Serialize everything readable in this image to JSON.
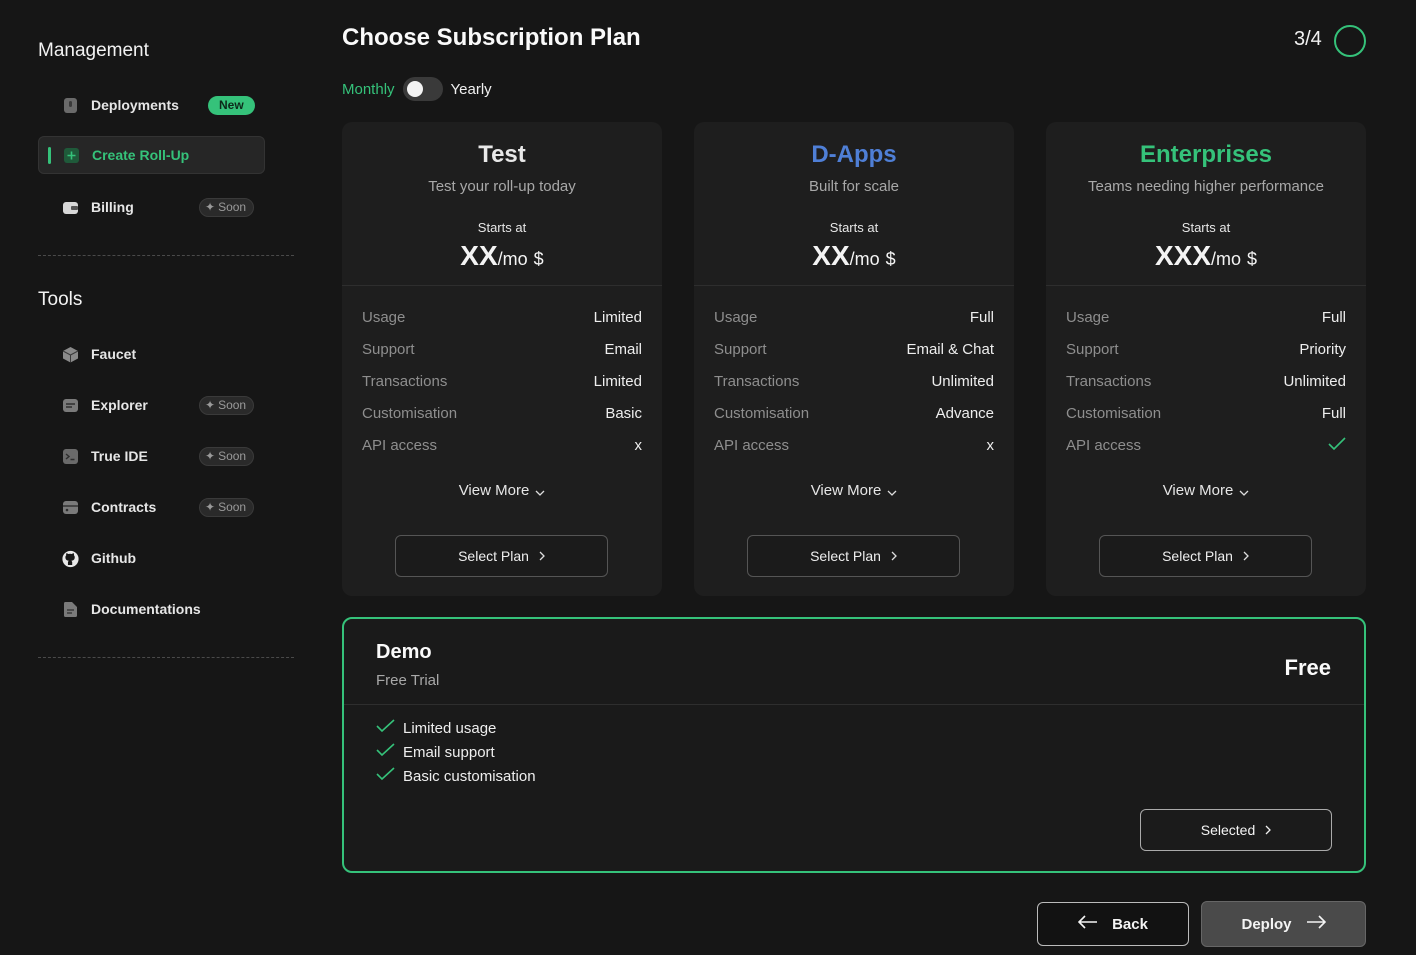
{
  "sidebar": {
    "management_title": "Management",
    "tools_title": "Tools",
    "management_items": [
      {
        "label": "Deployments",
        "badge": "New"
      },
      {
        "label": "Create Roll-Up"
      },
      {
        "label": "Billing",
        "badge": "Soon"
      }
    ],
    "tools_items": [
      {
        "label": "Faucet"
      },
      {
        "label": "Explorer",
        "badge": "Soon"
      },
      {
        "label": "True IDE",
        "badge": "Soon"
      },
      {
        "label": "Contracts",
        "badge": "Soon"
      },
      {
        "label": "Github"
      },
      {
        "label": "Documentations"
      }
    ]
  },
  "header": {
    "title": "Choose Subscription Plan",
    "step": "3/4"
  },
  "billing_toggle": {
    "left": "Monthly",
    "right": "Yearly"
  },
  "plans": [
    {
      "name": "Test",
      "name_color": "#e8e8e8",
      "description": "Test your roll-up today",
      "starts_at": "Starts at",
      "price": "XX",
      "per": "/mo",
      "currency": "$",
      "features": [
        {
          "k": "Usage",
          "v": "Limited"
        },
        {
          "k": "Support",
          "v": "Email"
        },
        {
          "k": "Transactions",
          "v": "Limited"
        },
        {
          "k": "Customisation",
          "v": "Basic"
        },
        {
          "k": "API access",
          "v": "x"
        }
      ],
      "view_more": "View More",
      "select": "Select Plan"
    },
    {
      "name": "D-Apps",
      "name_color": "#4f7fd6",
      "description": "Built for scale",
      "starts_at": "Starts at",
      "price": "XX",
      "per": "/mo",
      "currency": "$",
      "features": [
        {
          "k": "Usage",
          "v": "Full"
        },
        {
          "k": "Support",
          "v": "Email & Chat"
        },
        {
          "k": "Transactions",
          "v": "Unlimited"
        },
        {
          "k": "Customisation",
          "v": "Advance"
        },
        {
          "k": "API access",
          "v": "x"
        }
      ],
      "view_more": "View More",
      "select": "Select Plan"
    },
    {
      "name": "Enterprises",
      "name_color": "#35c27a",
      "description": "Teams needing higher performance",
      "starts_at": "Starts at",
      "price": "XXX",
      "per": "/mo",
      "currency": "$",
      "features": [
        {
          "k": "Usage",
          "v": "Full"
        },
        {
          "k": "Support",
          "v": "Priority"
        },
        {
          "k": "Transactions",
          "v": "Unlimited"
        },
        {
          "k": "Customisation",
          "v": "Full"
        },
        {
          "k": "API access",
          "v": ""
        }
      ],
      "view_more": "View More",
      "select": "Select Plan"
    }
  ],
  "demo": {
    "name": "Demo",
    "subtitle": "Free Trial",
    "price": "Free",
    "features": [
      "Limited usage",
      "Email support",
      "Basic customisation"
    ],
    "button": "Selected"
  },
  "footer": {
    "back": "Back",
    "deploy": "Deploy"
  },
  "colors": {
    "accent": "#35c27a",
    "dapps": "#4f7fd6",
    "background": "#161616",
    "card": "#1e1e1e"
  }
}
